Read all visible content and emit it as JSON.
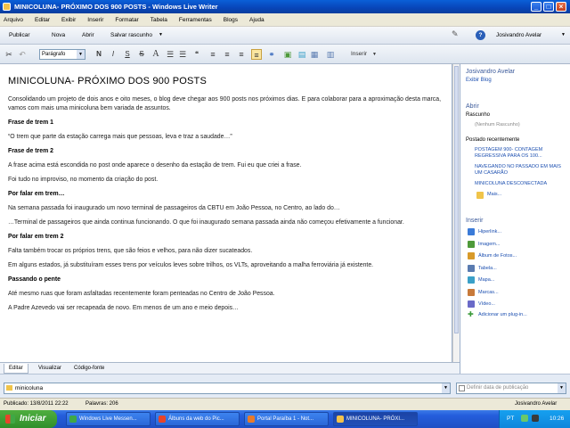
{
  "window": {
    "title": "MINICOLUNA- PRÓXIMO DOS 900 POSTS - Windows Live Writer"
  },
  "menu": [
    "Arquivo",
    "Editar",
    "Exibir",
    "Inserir",
    "Formatar",
    "Tabela",
    "Ferramentas",
    "Blogs",
    "Ajuda"
  ],
  "toolbar": {
    "publish": "Publicar",
    "new": "Nova",
    "open": "Abrir",
    "save_draft": "Salvar rascunho",
    "user": "Josivandro Avelar"
  },
  "format": {
    "style": "Parágrafo",
    "insert": "Inserir"
  },
  "post": {
    "title": "MINICOLUNA- PRÓXIMO DOS 900 POSTS",
    "paragraphs": [
      {
        "text": "Consolidando um projeto de dois anos e oito meses, o blog deve chegar aos 900 posts nos próximos dias. E para colaborar para a aproximação desta marca, vamos com mais uma minicoluna bem variada de assuntos.",
        "bold": false
      },
      {
        "text": "Frase de trem 1",
        "bold": true
      },
      {
        "text": "“O trem que parte da estação carrega mais que pessoas, leva e traz a saudade…”",
        "bold": false
      },
      {
        "text": "Frase de trem 2",
        "bold": true
      },
      {
        "text": "A frase acima está escondida no post onde aparece o desenho da estação de trem. Fui eu que criei a frase.",
        "bold": false
      },
      {
        "text": "Foi tudo no improviso, no momento da criação do post.",
        "bold": false
      },
      {
        "text": "Por falar em trem…",
        "bold": true
      },
      {
        "text": "Na semana passada foi inaugurado um novo terminal de passageiros da CBTU em João Pessoa, no Centro, ao lado do…",
        "bold": false
      },
      {
        "text": "…Terminal de passageiros que ainda continua funcionando. O que foi inaugurado semana passada ainda não começou efetivamente a funcionar.",
        "bold": false
      },
      {
        "text": "Por falar em trem 2",
        "bold": true
      },
      {
        "text": "Falta também trocar os próprios trens, que são feios e velhos, para não dizer sucateados.",
        "bold": false
      },
      {
        "text": "Em alguns estados, já substituíram esses trens por veículos leves sobre trilhos, os VLTs, aproveitando a malha ferroviária já existente.",
        "bold": false
      },
      {
        "text": "Passando o pente",
        "bold": true
      },
      {
        "text": "Até mesmo ruas que foram asfaltadas recentemente foram penteadas no Centro de João Pessoa.",
        "bold": false
      },
      {
        "text": "A Padre Azevedo vai ser recapeada de novo. Em menos de um ano e meio depois…",
        "bold": false
      }
    ]
  },
  "side": {
    "user": "Josivandro Avelar",
    "view_blog": "Exibir Blog",
    "open_head": "Abrir",
    "drafts": "Rascunho",
    "no_drafts": "(Nenhum Rascunho)",
    "recent_head": "Postado recentemente",
    "recent": [
      "POSTAGEM 900- CONTAGEM REGRESSIVA PARA OS 100...",
      "NAVEGANDO NO PASSADO EM MAIS UM CASARÃO",
      "MINICOLUNA DESCONECTADA"
    ],
    "more": "Mais...",
    "insert_head": "Inserir",
    "insert_items": [
      {
        "label": "Hiperlink...",
        "color": "#3b7bd8"
      },
      {
        "label": "Imagem...",
        "color": "#4e9a3a"
      },
      {
        "label": "Álbum de Fotos...",
        "color": "#d89a2a"
      },
      {
        "label": "Tabela...",
        "color": "#5a7bb0"
      },
      {
        "label": "Mapa...",
        "color": "#3aa0c8"
      },
      {
        "label": "Marcas...",
        "color": "#c87a3a"
      },
      {
        "label": "Vídeo...",
        "color": "#6a6ac8"
      }
    ],
    "add_plugin": "Adicionar um plug-in..."
  },
  "tabs": [
    "Editar",
    "Visualizar",
    "Código-fonte"
  ],
  "category": "minicoluna",
  "date_placeholder": "Definir data de publicação",
  "status": {
    "published": "Publicado: 13/8/2011 22:22",
    "words": "Palavras: 206",
    "user": "Josivandro Avelar"
  },
  "taskbar": {
    "start": "Iniciar",
    "tasks": [
      {
        "label": "Windows Live Messen...",
        "color": "#3fa845"
      },
      {
        "label": "Álbuns da web do Pic...",
        "color": "#e8442a"
      },
      {
        "label": "Portal Paraíba 1 - Not...",
        "color": "#e87a2a"
      },
      {
        "label": "MINICOLUNA- PRÓXI...",
        "color": "#f3c24b"
      }
    ],
    "lang": "PT",
    "clock": "10:26"
  }
}
